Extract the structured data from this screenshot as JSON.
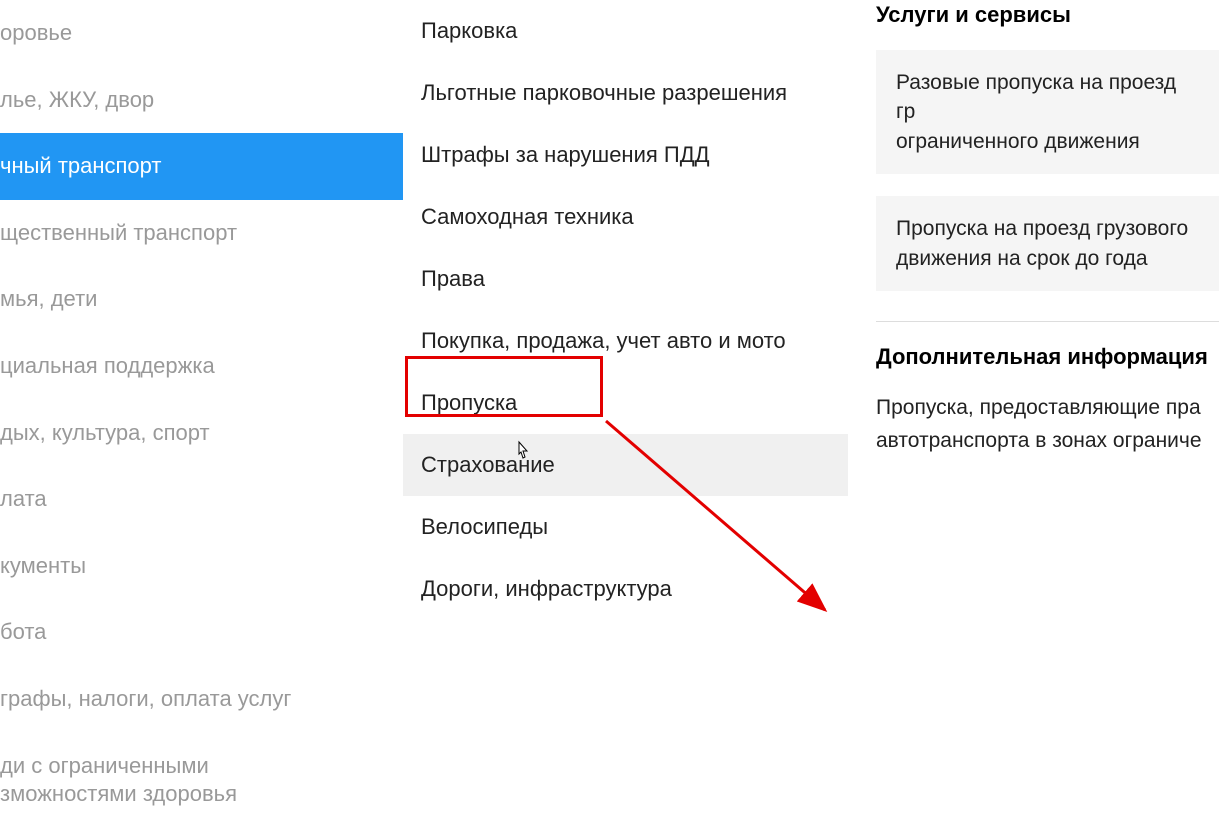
{
  "sidebar": {
    "items": [
      {
        "label": "оровье"
      },
      {
        "label": "лье, ЖКУ, двор"
      },
      {
        "label": "чный транспорт",
        "active": true
      },
      {
        "label": "щественный транспорт"
      },
      {
        "label": "мья, дети"
      },
      {
        "label": "циальная поддержка"
      },
      {
        "label": "дых, культура, спорт"
      },
      {
        "label": "лата"
      },
      {
        "label": "кументы"
      },
      {
        "label": "бота"
      },
      {
        "label": "графы, налоги, оплата услуг"
      },
      {
        "label": "ди с ограниченными\nзможностями здоровья"
      }
    ]
  },
  "middle": {
    "items": [
      {
        "label": "Парковка"
      },
      {
        "label": "Льготные парковочные разрешения"
      },
      {
        "label": "Штрафы за нарушения ПДД"
      },
      {
        "label": "Самоходная техника"
      },
      {
        "label": "Права"
      },
      {
        "label": "Покупка, продажа, учет авто и мото"
      },
      {
        "label": "Пропуска",
        "highlighted": true
      },
      {
        "label": "Страхование",
        "hovered": true
      },
      {
        "label": "Велосипеды"
      },
      {
        "label": "Дороги, инфраструктура"
      }
    ]
  },
  "right": {
    "services_heading": "Услуги и сервисы",
    "services": [
      {
        "text": "Разовые пропуска на проезд гр\nограниченного движения"
      },
      {
        "text": "Пропуска на проезд грузового\nдвижения на срок до года"
      }
    ],
    "info_heading": "Дополнительная информация",
    "info_text": "Пропуска, предоставляющие пра\nавтотранспорта в зонах ограниче"
  }
}
